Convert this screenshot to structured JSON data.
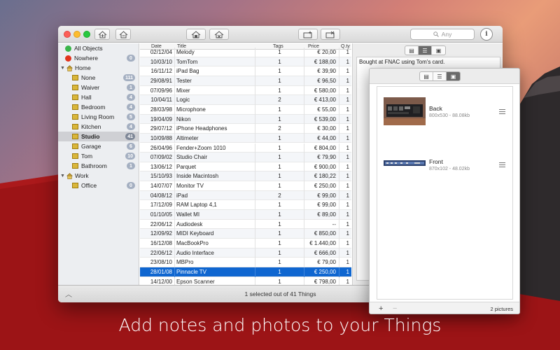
{
  "caption": "Add notes and photos to your Things",
  "colors": {
    "accent": "#0f66d0",
    "badge": "#a4afc1",
    "red_band": "#9c1416"
  },
  "toolbar": {
    "buttons": [
      "add-home-icon",
      "remove-home-icon",
      "add-room-icon",
      "remove-room-icon",
      "add-thing-icon",
      "remove-thing-icon"
    ],
    "search_placeholder": "Any",
    "info_label": "i"
  },
  "sidebar": {
    "all_objects": "All Objects",
    "nowhere": {
      "label": "Nowhere",
      "count": "0"
    },
    "home": {
      "label": "Home",
      "rooms": [
        {
          "label": "None",
          "count": "111"
        },
        {
          "label": "Waiver",
          "count": "1"
        },
        {
          "label": "Hall",
          "count": "4"
        },
        {
          "label": "Bedroom",
          "count": "4"
        },
        {
          "label": "Living Room",
          "count": "5"
        },
        {
          "label": "Kitchen",
          "count": "4"
        },
        {
          "label": "Studio",
          "count": "41"
        },
        {
          "label": "Garage",
          "count": "6"
        },
        {
          "label": "Tom",
          "count": "10"
        },
        {
          "label": "Bathroom",
          "count": "1"
        }
      ]
    },
    "work": {
      "label": "Work",
      "rooms": [
        {
          "label": "Office",
          "count": "0"
        }
      ]
    }
  },
  "table": {
    "headers": {
      "date": "Date",
      "title": "Title",
      "tags": "Tags",
      "price": "Price",
      "qty": "Q.ty"
    },
    "rows": [
      {
        "date": "02/12/04",
        "title": "Melody",
        "tags": "1",
        "price": "€ 20,00",
        "qty": "1"
      },
      {
        "date": "10/03/10",
        "title": "TomTom",
        "tags": "1",
        "price": "€ 188,00",
        "qty": "1"
      },
      {
        "date": "16/11/12",
        "title": "iPad Bag",
        "tags": "1",
        "price": "€ 39,90",
        "qty": "1"
      },
      {
        "date": "29/08/91",
        "title": "Tester",
        "tags": "1",
        "price": "€ 96,50",
        "qty": "1"
      },
      {
        "date": "07/09/96",
        "title": "Mixer",
        "tags": "1",
        "price": "€ 580,00",
        "qty": "1"
      },
      {
        "date": "10/04/11",
        "title": "Logic",
        "tags": "2",
        "price": "€ 413,00",
        "qty": "1"
      },
      {
        "date": "28/03/98",
        "title": "Microphone",
        "tags": "1",
        "price": "€ 55,00",
        "qty": "1"
      },
      {
        "date": "19/04/09",
        "title": "Nikon",
        "tags": "1",
        "price": "€ 539,00",
        "qty": "1"
      },
      {
        "date": "29/07/12",
        "title": "iPhone Headphones",
        "tags": "2",
        "price": "€ 30,00",
        "qty": "1"
      },
      {
        "date": "10/09/88",
        "title": "Altimeter",
        "tags": "1",
        "price": "€ 44,00",
        "qty": "1"
      },
      {
        "date": "26/04/96",
        "title": "Fender+Zoom 1010",
        "tags": "1",
        "price": "€ 804,00",
        "qty": "1"
      },
      {
        "date": "07/09/02",
        "title": "Studio Chair",
        "tags": "1",
        "price": "€ 79,90",
        "qty": "1"
      },
      {
        "date": "13/06/12",
        "title": "Parquet",
        "tags": "1",
        "price": "€ 900,00",
        "qty": "1"
      },
      {
        "date": "15/10/93",
        "title": "Inside Macintosh",
        "tags": "1",
        "price": "€ 180,22",
        "qty": "1"
      },
      {
        "date": "14/07/07",
        "title": "Monitor TV",
        "tags": "1",
        "price": "€ 250,00",
        "qty": "1"
      },
      {
        "date": "04/08/12",
        "title": "iPad",
        "tags": "2",
        "price": "€ 99,00",
        "qty": "1"
      },
      {
        "date": "17/12/09",
        "title": "RAM Laptop 4,1",
        "tags": "1",
        "price": "€ 99,00",
        "qty": "1"
      },
      {
        "date": "01/10/05",
        "title": "Wallet MI",
        "tags": "1",
        "price": "€ 89,00",
        "qty": "1"
      },
      {
        "date": "22/06/12",
        "title": "Audiodesk",
        "tags": "1",
        "price": "--",
        "qty": "1"
      },
      {
        "date": "12/09/92",
        "title": "MIDI Keyboard",
        "tags": "1",
        "price": "€ 850,00",
        "qty": "1"
      },
      {
        "date": "16/12/08",
        "title": "MacBookPro",
        "tags": "1",
        "price": "€ 1.440,00",
        "qty": "1"
      },
      {
        "date": "22/06/12",
        "title": "Audio Interface",
        "tags": "1",
        "price": "€ 666,00",
        "qty": "1"
      },
      {
        "date": "23/08/10",
        "title": "MBPro",
        "tags": "1",
        "price": "€ 79,00",
        "qty": "1"
      },
      {
        "date": "28/01/08",
        "title": "Pinnacle TV",
        "tags": "1",
        "price": "€ 250,00",
        "qty": "1",
        "selected": true
      },
      {
        "date": "14/12/00",
        "title": "Epson Scanner",
        "tags": "1",
        "price": "€ 798,00",
        "qty": "1"
      }
    ]
  },
  "detail": {
    "note": "Bought at FNAC using Tom's card."
  },
  "status": {
    "text": "1 selected out of 41 Things"
  },
  "pictures": {
    "items": [
      {
        "name": "Back",
        "size": "800x530 - 88.08kb"
      },
      {
        "name": "Front",
        "size": "870x102 - 48.02kb"
      }
    ],
    "add_label": "+",
    "remove_label": "−",
    "count": "2 pictures"
  }
}
